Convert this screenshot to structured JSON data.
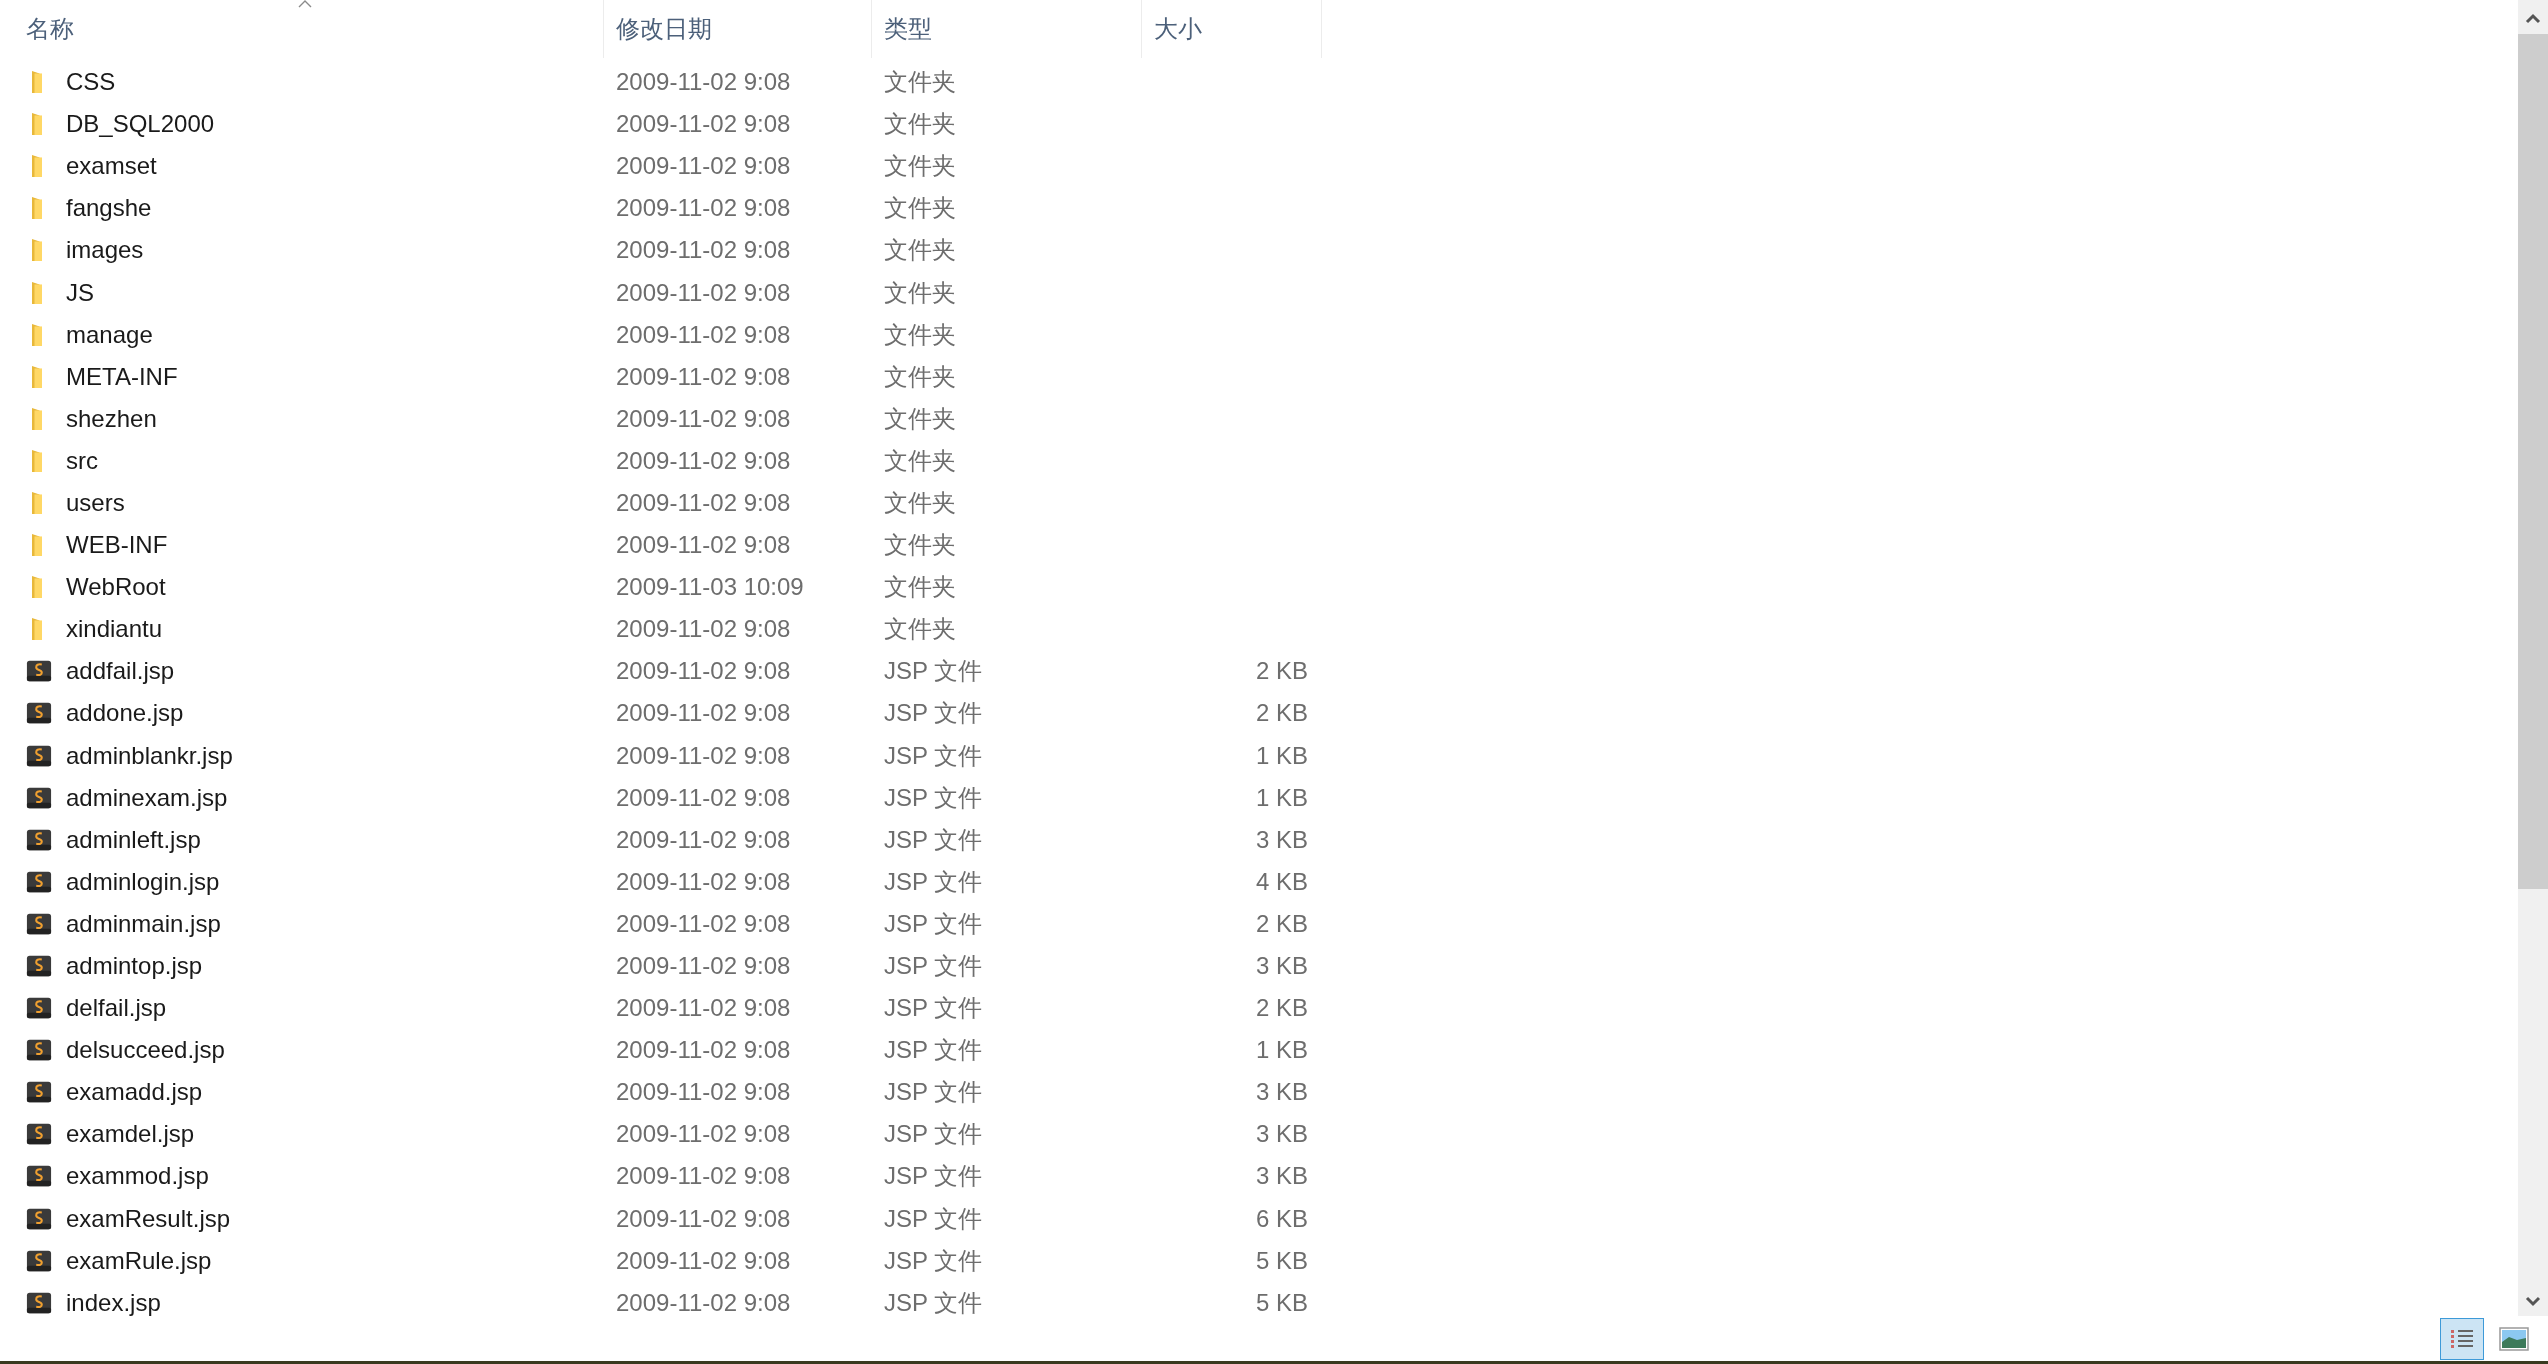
{
  "columns": [
    {
      "label": "名称",
      "sorted": true
    },
    {
      "label": "修改日期",
      "sorted": false
    },
    {
      "label": "类型",
      "sorted": false
    },
    {
      "label": "大小",
      "sorted": false
    }
  ],
  "files": [
    {
      "kind": "folder",
      "name": "CSS",
      "modified": "2009-11-02 9:08",
      "type": "文件夹"
    },
    {
      "kind": "folder",
      "name": "DB_SQL2000",
      "modified": "2009-11-02 9:08",
      "type": "文件夹"
    },
    {
      "kind": "folder",
      "name": "examset",
      "modified": "2009-11-02 9:08",
      "type": "文件夹"
    },
    {
      "kind": "folder",
      "name": "fangshe",
      "modified": "2009-11-02 9:08",
      "type": "文件夹"
    },
    {
      "kind": "folder",
      "name": "images",
      "modified": "2009-11-02 9:08",
      "type": "文件夹"
    },
    {
      "kind": "folder",
      "name": "JS",
      "modified": "2009-11-02 9:08",
      "type": "文件夹"
    },
    {
      "kind": "folder",
      "name": "manage",
      "modified": "2009-11-02 9:08",
      "type": "文件夹"
    },
    {
      "kind": "folder",
      "name": "META-INF",
      "modified": "2009-11-02 9:08",
      "type": "文件夹"
    },
    {
      "kind": "folder",
      "name": "shezhen",
      "modified": "2009-11-02 9:08",
      "type": "文件夹"
    },
    {
      "kind": "folder",
      "name": "src",
      "modified": "2009-11-02 9:08",
      "type": "文件夹"
    },
    {
      "kind": "folder",
      "name": "users",
      "modified": "2009-11-02 9:08",
      "type": "文件夹"
    },
    {
      "kind": "folder",
      "name": "WEB-INF",
      "modified": "2009-11-02 9:08",
      "type": "文件夹"
    },
    {
      "kind": "folder",
      "name": "WebRoot",
      "modified": "2009-11-03 10:09",
      "type": "文件夹"
    },
    {
      "kind": "folder",
      "name": "xindiantu",
      "modified": "2009-11-02 9:08",
      "type": "文件夹"
    },
    {
      "kind": "jsp",
      "name": "addfail.jsp",
      "modified": "2009-11-02 9:08",
      "type": "JSP 文件",
      "size": "2 KB"
    },
    {
      "kind": "jsp",
      "name": "addone.jsp",
      "modified": "2009-11-02 9:08",
      "type": "JSP 文件",
      "size": "2 KB"
    },
    {
      "kind": "jsp",
      "name": "adminblankr.jsp",
      "modified": "2009-11-02 9:08",
      "type": "JSP 文件",
      "size": "1 KB"
    },
    {
      "kind": "jsp",
      "name": "adminexam.jsp",
      "modified": "2009-11-02 9:08",
      "type": "JSP 文件",
      "size": "1 KB"
    },
    {
      "kind": "jsp",
      "name": "adminleft.jsp",
      "modified": "2009-11-02 9:08",
      "type": "JSP 文件",
      "size": "3 KB"
    },
    {
      "kind": "jsp",
      "name": "adminlogin.jsp",
      "modified": "2009-11-02 9:08",
      "type": "JSP 文件",
      "size": "4 KB"
    },
    {
      "kind": "jsp",
      "name": "adminmain.jsp",
      "modified": "2009-11-02 9:08",
      "type": "JSP 文件",
      "size": "2 KB"
    },
    {
      "kind": "jsp",
      "name": "admintop.jsp",
      "modified": "2009-11-02 9:08",
      "type": "JSP 文件",
      "size": "3 KB"
    },
    {
      "kind": "jsp",
      "name": "delfail.jsp",
      "modified": "2009-11-02 9:08",
      "type": "JSP 文件",
      "size": "2 KB"
    },
    {
      "kind": "jsp",
      "name": "delsucceed.jsp",
      "modified": "2009-11-02 9:08",
      "type": "JSP 文件",
      "size": "1 KB"
    },
    {
      "kind": "jsp",
      "name": "examadd.jsp",
      "modified": "2009-11-02 9:08",
      "type": "JSP 文件",
      "size": "3 KB"
    },
    {
      "kind": "jsp",
      "name": "examdel.jsp",
      "modified": "2009-11-02 9:08",
      "type": "JSP 文件",
      "size": "3 KB"
    },
    {
      "kind": "jsp",
      "name": "exammod.jsp",
      "modified": "2009-11-02 9:08",
      "type": "JSP 文件",
      "size": "3 KB"
    },
    {
      "kind": "jsp",
      "name": "examResult.jsp",
      "modified": "2009-11-02 9:08",
      "type": "JSP 文件",
      "size": "6 KB"
    },
    {
      "kind": "jsp",
      "name": "examRule.jsp",
      "modified": "2009-11-02 9:08",
      "type": "JSP 文件",
      "size": "5 KB"
    },
    {
      "kind": "jsp",
      "name": "index.jsp",
      "modified": "2009-11-02 9:08",
      "type": "JSP 文件",
      "size": "5 KB"
    }
  ],
  "view_buttons": [
    {
      "kind": "details",
      "selected": true
    },
    {
      "kind": "large-icons",
      "selected": false
    }
  ]
}
